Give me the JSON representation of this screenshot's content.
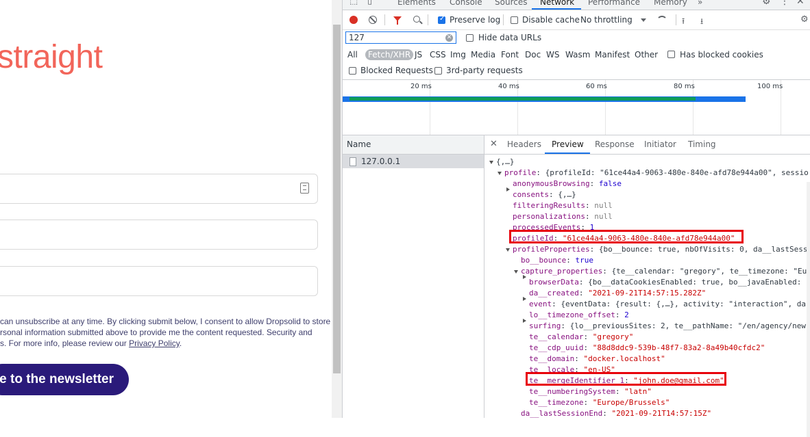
{
  "page": {
    "headline": "straight",
    "consent_lines": [
      "can unsubscribe at any time. By clicking submit below, I consent to allow Dropsolid to store",
      "rsonal information submitted above to provide me the content requested. Security and",
      "s. For more info, please review our "
    ],
    "privacy_link": "Privacy Policy",
    "consent_end": ".",
    "newsletter_button": "be to the newsletter"
  },
  "devtools": {
    "panel_tabs": [
      "Elements",
      "Console",
      "Sources",
      "Network",
      "Performance",
      "Memory",
      "»"
    ],
    "active_panel": "Network",
    "toolbar": {
      "preserve_log": "Preserve log",
      "disable_cache": "Disable cache",
      "throttling": "No throttling"
    },
    "filter": {
      "value": "127",
      "hide_data_urls": "Hide data URLs",
      "types": [
        "All",
        "Fetch/XHR",
        "JS",
        "CSS",
        "Img",
        "Media",
        "Font",
        "Doc",
        "WS",
        "Wasm",
        "Manifest",
        "Other"
      ],
      "active_type": "Fetch/XHR",
      "has_blocked_cookies": "Has blocked cookies",
      "blocked_requests": "Blocked Requests",
      "third_party": "3rd-party requests"
    },
    "overview": {
      "ticks": [
        "20 ms",
        "40 ms",
        "60 ms",
        "80 ms",
        "100 ms"
      ]
    },
    "requests": {
      "header": "Name",
      "items": [
        "127.0.0.1"
      ]
    },
    "detail_tabs": [
      "Headers",
      "Preview",
      "Response",
      "Initiator",
      "Timing"
    ],
    "active_detail_tab": "Preview",
    "preview": {
      "root": "{,…}",
      "l1_key": "profile",
      "l1_val": "{profileId: \"61ce44a4-9063-480e-840e-afd78e944a00\", sessio",
      "anonymousBrowsing": "false",
      "consents": "{,…}",
      "filteringResults": "null",
      "personalizations": "null",
      "processedEvents": "1",
      "profileId": "\"61ce44a4-9063-480e-840e-afd78e944a00\"",
      "profileProperties": "{bo__bounce: true, nbOfVisits: 0, da__lastSess",
      "bo__bounce": "true",
      "capture_properties": "{te__calendar: \"gregory\", te__timezone: \"Eu",
      "browserData": "{bo__dataCookiesEnabled: true, bo__javaEnabled:",
      "da__created": "\"2021-09-21T14:57:15.282Z\"",
      "event": "{eventData: {result: {,…}, activity: \"interaction\", da",
      "lo__timezone_offset": "2",
      "surfing": "{lo__previousSites: 2, te__pathName: \"/en/agency/new",
      "te__calendar": "\"gregory\"",
      "te__cdp_uuid": "\"88d8ddc9-539b-48f7-83a2-8a49b40cfdc2\"",
      "te__domain": "\"docker.localhost\"",
      "te__locale": "\"en-US\"",
      "te__mergeIdentifier_1": "\"john.doe@gmail.com\"",
      "te__numberingSystem": "\"latn\"",
      "te__timezone": "\"Europe/Brussels\"",
      "da__lastSessionEnd": "\"2021-09-21T14:57:15Z\""
    }
  }
}
